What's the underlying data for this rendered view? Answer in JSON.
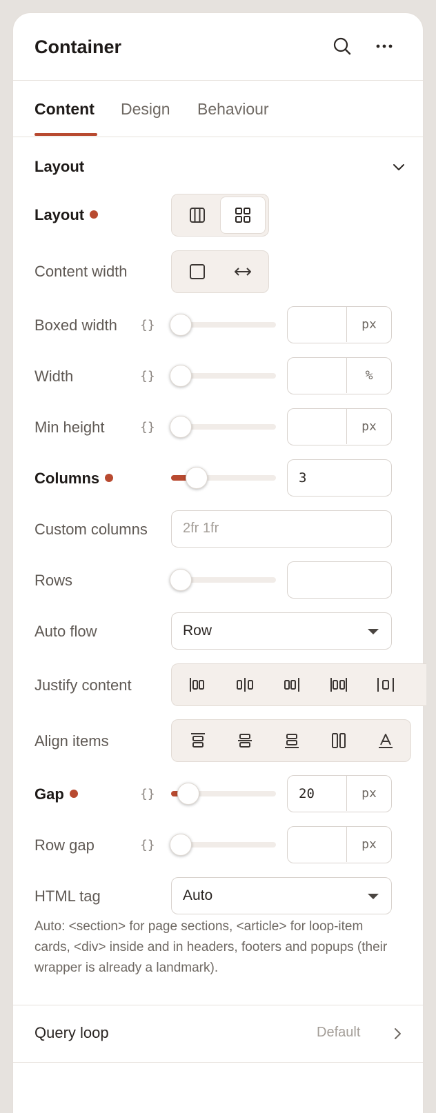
{
  "panel": {
    "title": "Container",
    "icons": {
      "search": "search-icon",
      "more": "more-horizontal-icon"
    }
  },
  "tabs": [
    {
      "label": "Content",
      "active": true
    },
    {
      "label": "Design",
      "active": false
    },
    {
      "label": "Behaviour",
      "active": false
    }
  ],
  "section": {
    "title": "Layout",
    "expanded": true
  },
  "fields": {
    "layout": {
      "label": "Layout",
      "modified": true,
      "options": [
        "flex-icon",
        "grid-icon"
      ],
      "selected": "grid-icon"
    },
    "content_width": {
      "label": "Content width",
      "options": [
        "boxed-icon",
        "full-width-icon"
      ]
    },
    "boxed_width": {
      "label": "Boxed width",
      "dynamic": "{}",
      "value": "",
      "unit": "px",
      "slider": 0
    },
    "width": {
      "label": "Width",
      "dynamic": "{}",
      "value": "",
      "unit": "%",
      "slider": 0
    },
    "min_height": {
      "label": "Min height",
      "dynamic": "{}",
      "value": "",
      "unit": "px",
      "slider": 0
    },
    "columns": {
      "label": "Columns",
      "modified": true,
      "value": "3",
      "slider": 0.24
    },
    "custom_columns": {
      "label": "Custom columns",
      "placeholder": "2fr 1fr"
    },
    "rows": {
      "label": "Rows",
      "value": "",
      "slider": 0
    },
    "auto_flow": {
      "label": "Auto flow",
      "value": "Row"
    },
    "justify_content": {
      "label": "Justify content",
      "options": [
        "justify-start-icon",
        "justify-center-icon",
        "justify-end-icon",
        "justify-space-between-icon",
        "justify-space-around-icon"
      ]
    },
    "align_items": {
      "label": "Align items",
      "options": [
        "align-start-icon",
        "align-center-icon",
        "align-end-icon",
        "align-stretch-icon",
        "align-baseline-icon"
      ]
    },
    "gap": {
      "label": "Gap",
      "modified": true,
      "dynamic": "{}",
      "value": "20",
      "unit": "px",
      "slider": 0.1
    },
    "row_gap": {
      "label": "Row gap",
      "dynamic": "{}",
      "value": "",
      "unit": "px",
      "slider": 0
    },
    "html_tag": {
      "label": "HTML tag",
      "value": "Auto"
    }
  },
  "help_text": "Auto: <section> for page sections, <article> for loop-item cards, <div> inside and in headers, footers and popups (their wrapper is already a landmark).",
  "query_loop": {
    "label": "Query loop",
    "value": "Default"
  },
  "colors": {
    "accent": "#b84a30",
    "muted": "#6e6862",
    "background": "#e6e2de"
  }
}
